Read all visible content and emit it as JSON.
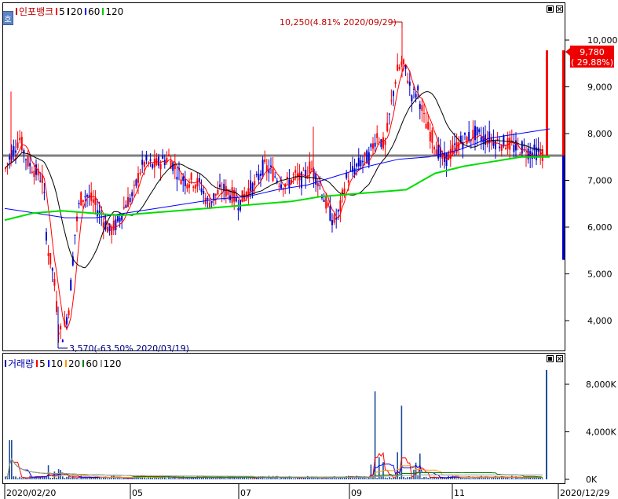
{
  "price_panel": {
    "legend": [
      {
        "label": "인포뱅크",
        "color": "#c00000"
      },
      {
        "label": "5",
        "color": "#ff0000"
      },
      {
        "label": "20",
        "color": "#000000"
      },
      {
        "label": "60",
        "color": "#0000ff"
      },
      {
        "label": "120",
        "color": "#00cc00"
      }
    ],
    "corner_button": "호",
    "y_ticks": [
      "10,000",
      "9,000",
      "8,000",
      "7,000",
      "6,000",
      "5,000",
      "4,000"
    ],
    "high_annotation": "10,250(4.81% 2020/09/29)",
    "low_annotation": "3,570(-63.50% 2020/03/19)",
    "last_price": "9,780",
    "last_change": "( 29.88%)",
    "colors": {
      "up": "#ff0000",
      "down": "#0000cc",
      "ma5": "#ff0000",
      "ma20": "#000000",
      "ma60": "#0000ff",
      "ma120": "#00dd00",
      "baseline": "#808080"
    }
  },
  "volume_panel": {
    "legend": [
      {
        "label": "거래량",
        "color": "#0000aa"
      },
      {
        "label": "5",
        "color": "#ff0000"
      },
      {
        "label": "10",
        "color": "#0000ff"
      },
      {
        "label": "20",
        "color": "#ff9900"
      },
      {
        "label": "60",
        "color": "#008000"
      },
      {
        "label": "120",
        "color": "#999999"
      }
    ],
    "y_ticks": [
      "8,000K",
      "4,000K",
      "0K"
    ]
  },
  "x_axis": {
    "labels": [
      "2020/02/20",
      "05",
      "07",
      "09",
      "11",
      "2020/12/29"
    ]
  },
  "chart_data": {
    "type": "line",
    "title": "인포뱅크",
    "price_ylim": [
      3400,
      10400
    ],
    "volume_ylim": [
      0,
      9500
    ],
    "series": [
      {
        "name": "120",
        "values": [
          6150,
          6300,
          6350,
          6300,
          6250,
          6300,
          6350,
          6400,
          6450,
          6500,
          6550,
          6650,
          6700,
          6750,
          6800,
          7150,
          7300,
          7400,
          7500,
          7500
        ]
      },
      {
        "name": "60",
        "values": [
          6400,
          6300,
          6200,
          6200,
          6300,
          6400,
          6500,
          6600,
          6650,
          6800,
          6900,
          7100,
          7300,
          7450,
          7500,
          7650,
          7900,
          8000,
          8100
        ]
      }
    ],
    "high": {
      "value": 10250,
      "date": "2020/09/29",
      "change_pct": 4.81
    },
    "low": {
      "value": 3570,
      "date": "2020/03/19",
      "change_pct": -63.5
    },
    "last": {
      "value": 9780,
      "change_pct": 29.88
    },
    "volume_max_k": 9200
  }
}
